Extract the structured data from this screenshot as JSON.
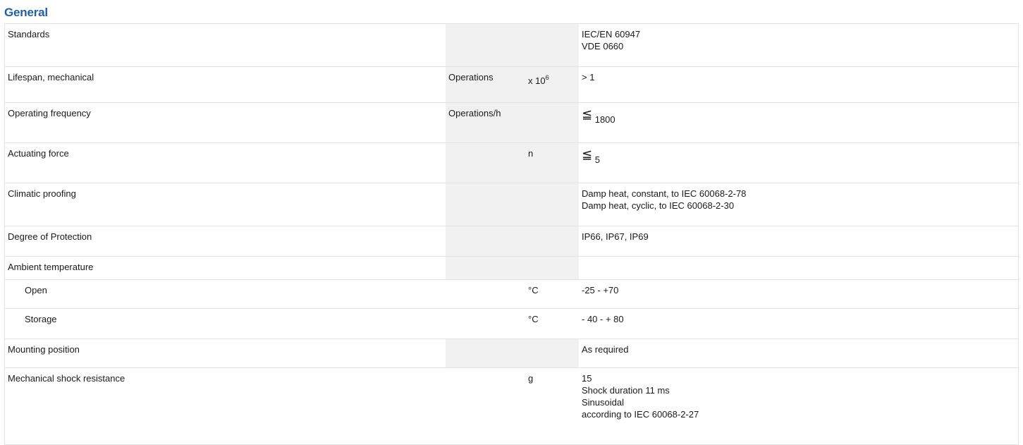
{
  "section": {
    "title": "General"
  },
  "rows": {
    "standards": {
      "label": "Standards",
      "unit": "",
      "mult": "",
      "values": [
        "IEC/EN 60947",
        "VDE 0660"
      ]
    },
    "lifespan": {
      "label": "Lifespan, mechanical",
      "unit": "Operations",
      "mult_base": "x 10",
      "mult_exp": "6",
      "value": "> 1"
    },
    "frequency": {
      "label": "Operating frequency",
      "unit": "Operations/h",
      "mult": "",
      "icon": "less-than-or-equal-icon",
      "icon_glyph": "≦",
      "value": "1800"
    },
    "force": {
      "label": "Actuating force",
      "unit": "",
      "mult": "n",
      "icon": "less-than-or-equal-icon",
      "icon_glyph": "≦",
      "value": "5"
    },
    "climatic": {
      "label": "Climatic proofing",
      "unit": "",
      "mult": "",
      "values": [
        "Damp heat, constant, to IEC 60068-2-78",
        "Damp heat, cyclic, to IEC 60068-2-30"
      ]
    },
    "degree": {
      "label": "Degree of Protection",
      "unit": "",
      "mult": "",
      "value": "IP66, IP67, IP69"
    },
    "ambient": {
      "label": "Ambient temperature",
      "unit": "",
      "mult": "",
      "value": ""
    },
    "open": {
      "label": "Open",
      "unit": "",
      "mult": "°C",
      "value": "-25 - +70"
    },
    "storage": {
      "label": "Storage",
      "unit": "",
      "mult": "°C",
      "value": "- 40 - + 80"
    },
    "mounting": {
      "label": "Mounting position",
      "unit": "",
      "mult": "",
      "value": "As required"
    },
    "shock": {
      "label": "Mechanical shock resistance",
      "unit": "",
      "mult": "g",
      "values": [
        "15",
        "Shock duration 11 ms",
        "Sinusoidal",
        "according to IEC 60068-2-27"
      ]
    }
  }
}
